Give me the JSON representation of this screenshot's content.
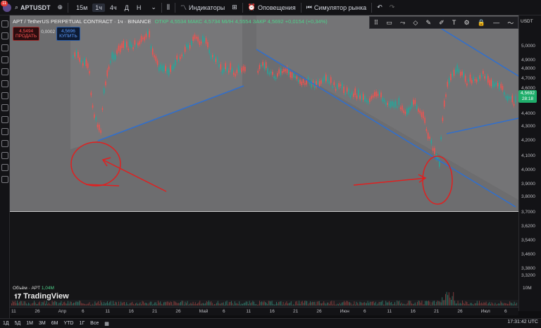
{
  "topbar": {
    "notif_count": "11",
    "symbol": "APTUSDT",
    "timeframes": [
      "15м",
      "1ч",
      "4ч",
      "Д",
      "Н"
    ],
    "active_timeframe": "1ч",
    "indicators_label": "Индикаторы",
    "alerts_label": "Оповещения",
    "simulator_label": "Симулятор рынка"
  },
  "legend": {
    "title": "APT / TetherUS PERPETUAL CONTRACT · 1ч · BINANCE",
    "values": "ОТКР 4,5534  МАКС 4,5734  МИН 4,5554  ЗАКР 4,5692 +0,0154 (+0,34%)"
  },
  "order": {
    "sell_price": "4,5494",
    "sell_label": "ПРОДАТЬ",
    "spread": "0,0002",
    "buy_price": "4,5696",
    "buy_label": "КУПИТЬ"
  },
  "price_axis": {
    "currency": "USDT",
    "ticks": [
      "5,0000",
      "4,9000",
      "4,8000",
      "4,7000",
      "4,6000",
      "4,4000",
      "4,3000",
      "4,2000",
      "4,1000",
      "4,0000",
      "3,9000",
      "3,8000",
      "3,7000",
      "3,6200",
      "3,5400",
      "3,4600",
      "3,3800",
      "3,3200"
    ],
    "current_price": "4,5692",
    "countdown": "28:18"
  },
  "volume": {
    "label": "Объём · APT",
    "value": "1,04M",
    "axis_10m": "10M"
  },
  "brand": "TradingView",
  "time_axis": [
    "11",
    "26",
    "Апр",
    "6",
    "11",
    "16",
    "21",
    "26",
    "Май",
    "6",
    "11",
    "16",
    "21",
    "26",
    "Июн",
    "6",
    "11",
    "16",
    "21",
    "26",
    "Июл",
    "6"
  ],
  "bottombar": {
    "ranges": [
      "1Д",
      "5Д",
      "1М",
      "3М",
      "6М",
      "YTD",
      "1Г",
      "Все"
    ],
    "clock": "17:31:42 UTC"
  },
  "colors": {
    "up": "#26a69a",
    "down": "#ef5350",
    "trendline": "#2f6fcf",
    "annotation": "#e02020",
    "price_tag": "#1fae6b"
  }
}
